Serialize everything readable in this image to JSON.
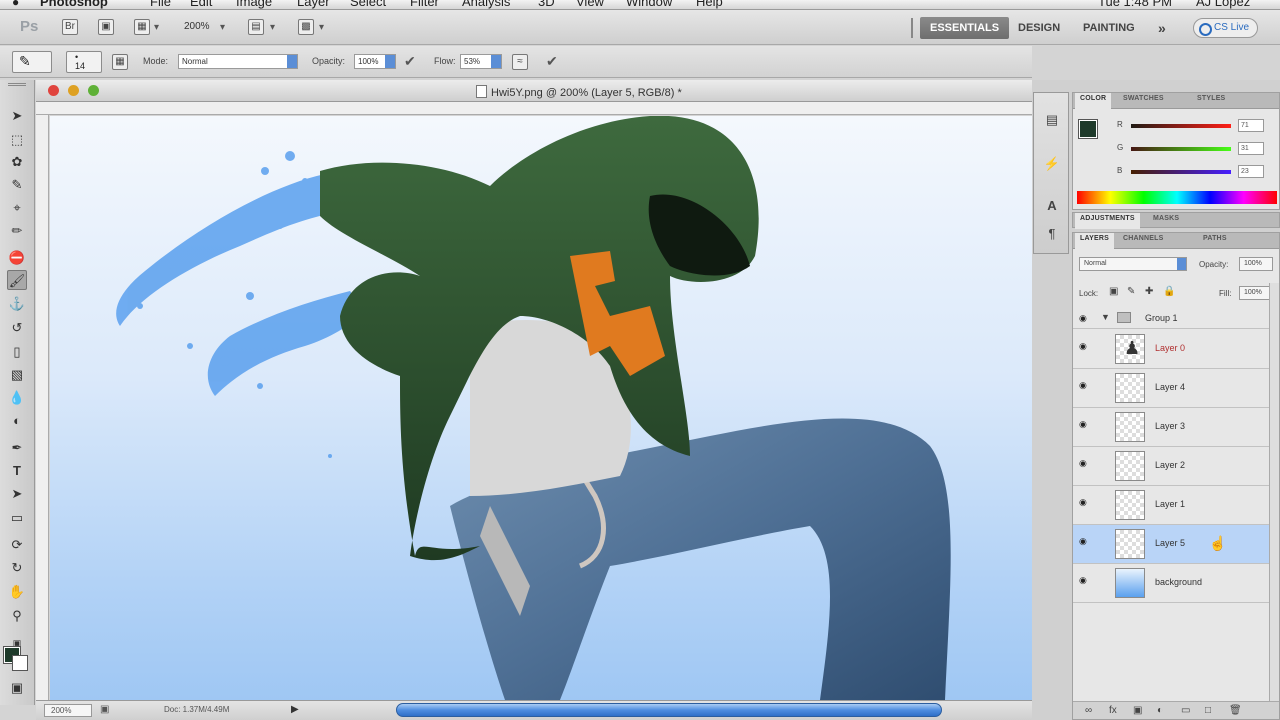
{
  "menubar": {
    "items": [
      "Photoshop",
      "File",
      "Edit",
      "Image",
      "Layer",
      "Select",
      "Filter",
      "Analysis",
      "3D",
      "View",
      "Window",
      "Help"
    ],
    "clock": "Tue 1:48 PM",
    "user": "AJ Lopez"
  },
  "appbar": {
    "logo": "Ps",
    "zoom": "200%",
    "workspaces": [
      "ESSENTIALS",
      "DESIGN",
      "PAINTING"
    ],
    "more": "»",
    "cs_live": "CS Live"
  },
  "options": {
    "mode_label": "Mode:",
    "mode_value": "Normal",
    "opacity_label": "Opacity:",
    "opacity_value": "100%",
    "flow_label": "Flow:",
    "flow_value": "53%"
  },
  "document": {
    "title": "Hwi5Y.png @ 200% (Layer 5, RGB/8) *",
    "status_zoom": "200%",
    "status_doc": "Doc: 1.37M/4.49M"
  },
  "color_panel": {
    "tabs": [
      "COLOR",
      "SWATCHES",
      "STYLES"
    ],
    "r_label": "R",
    "g_label": "G",
    "b_label": "B",
    "r": "71",
    "g": "31",
    "b": "23"
  },
  "adjustments_panel": {
    "tabs": [
      "ADJUSTMENTS",
      "MASKS"
    ]
  },
  "layers_panel": {
    "tabs": [
      "LAYERS",
      "CHANNELS",
      "PATHS"
    ],
    "blend_mode": "Normal",
    "opacity_label": "Opacity:",
    "opacity_value": "100%",
    "lock_label": "Lock:",
    "fill_label": "Fill:",
    "fill_value": "100%",
    "group_name": "Group 1",
    "layers": [
      {
        "name": "Layer 0",
        "selected": false,
        "color": "red"
      },
      {
        "name": "Layer 4",
        "selected": false,
        "color": "normal"
      },
      {
        "name": "Layer 3",
        "selected": false,
        "color": "normal"
      },
      {
        "name": "Layer 2",
        "selected": false,
        "color": "normal"
      },
      {
        "name": "Layer 1",
        "selected": false,
        "color": "normal"
      },
      {
        "name": "Layer 5",
        "selected": true,
        "color": "normal"
      },
      {
        "name": "background",
        "selected": false,
        "color": "normal"
      }
    ]
  },
  "colors": {
    "foreground": "#1e3a2a",
    "background": "#ffffff",
    "selection": "#b9d4f7",
    "scroll_accent": "#3d7fd6"
  },
  "icons": {
    "tools": [
      "move-tool-icon",
      "marquee-tool-icon",
      "lasso-tool-icon",
      "quick-select-tool-icon",
      "crop-tool-icon",
      "eyedropper-tool-icon",
      "healing-brush-icon",
      "brush-tool-icon",
      "clone-stamp-icon",
      "history-brush-icon",
      "eraser-tool-icon",
      "gradient-tool-icon",
      "blur-tool-icon",
      "dodge-tool-icon",
      "pen-tool-icon",
      "type-tool-icon",
      "path-select-icon",
      "shape-tool-icon",
      "3d-rotate-icon",
      "3d-orbit-icon",
      "hand-tool-icon",
      "zoom-tool-icon"
    ]
  }
}
